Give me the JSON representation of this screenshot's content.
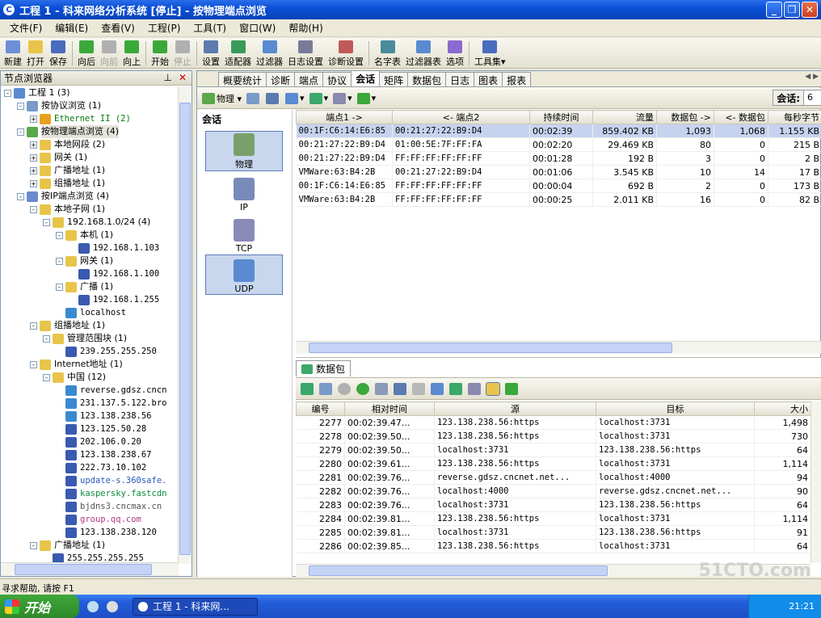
{
  "window": {
    "title": "工程 1 - 科来网络分析系统 [停止] - 按物理端点浏览"
  },
  "menu": [
    "文件(F)",
    "编辑(E)",
    "查看(V)",
    "工程(P)",
    "工具(T)",
    "窗口(W)",
    "帮助(H)"
  ],
  "toolbar": [
    {
      "label": "新建",
      "icon": "new-icon",
      "color": "#6d8fd8"
    },
    {
      "label": "打开",
      "icon": "open-icon",
      "color": "#e8c44a"
    },
    {
      "label": "保存",
      "icon": "save-icon",
      "color": "#4a6cc0"
    },
    {
      "label": "向后",
      "icon": "back-icon",
      "color": "#3aa83a"
    },
    {
      "label": "向前",
      "icon": "forward-icon",
      "color": "#b0b0b0",
      "disabled": true
    },
    {
      "label": "向上",
      "icon": "up-icon",
      "color": "#3aa83a"
    },
    {
      "label": "开始",
      "icon": "start-icon",
      "color": "#3aa83a"
    },
    {
      "label": "停止",
      "icon": "stop-icon",
      "color": "#b0b0b0",
      "disabled": true
    },
    {
      "label": "设置",
      "icon": "settings-icon",
      "color": "#5a7ab0"
    },
    {
      "label": "适配器",
      "icon": "adapter-icon",
      "color": "#3a9a5a"
    },
    {
      "label": "过滤器",
      "icon": "filter-icon",
      "color": "#5a8ad0"
    },
    {
      "label": "日志设置",
      "icon": "log-settings-icon",
      "color": "#7a7a9a"
    },
    {
      "label": "诊断设置",
      "icon": "diagnosis-settings-icon",
      "color": "#c05a5a"
    },
    {
      "label": "名字表",
      "icon": "name-table-icon",
      "color": "#4a8a9a"
    },
    {
      "label": "过滤器表",
      "icon": "filter-table-icon",
      "color": "#5a8ad0"
    },
    {
      "label": "选项",
      "icon": "options-icon",
      "color": "#8a6ad0"
    },
    {
      "label": "工具集▾",
      "icon": "toolset-icon",
      "color": "#4a6cc0"
    }
  ],
  "left_pane": {
    "title": "节点浏览器",
    "tree": [
      {
        "label": "工程 1 (3)",
        "level": 0,
        "exp": "-",
        "icon": "globe-icon",
        "color": "#5a8ad0"
      },
      {
        "label": "按协议浏览 (1)",
        "level": 1,
        "exp": "-",
        "icon": "filter-icon",
        "color": "#7a9ac8"
      },
      {
        "label": "Ethernet II (2)",
        "level": 2,
        "exp": "+",
        "icon": "filter-icon",
        "color": "#e8a020",
        "mono": true,
        "textcolor": "#0a7a0a"
      },
      {
        "label": "按物理端点浏览 (4)",
        "level": 1,
        "exp": "-",
        "icon": "network-icon",
        "color": "#5aa84a",
        "sel": true
      },
      {
        "label": "本地网段 (2)",
        "level": 2,
        "exp": "+",
        "icon": "folder-icon",
        "color": "#e8c44a"
      },
      {
        "label": "网关 (1)",
        "level": 2,
        "exp": "+",
        "icon": "folder-icon",
        "color": "#e8c44a"
      },
      {
        "label": "广播地址 (1)",
        "level": 2,
        "exp": "+",
        "icon": "folder-icon",
        "color": "#e8c44a"
      },
      {
        "label": "组播地址 (1)",
        "level": 2,
        "exp": "+",
        "icon": "folder-icon",
        "color": "#e8c44a"
      },
      {
        "label": "按IP端点浏览 (4)",
        "level": 1,
        "exp": "-",
        "icon": "network-icon",
        "color": "#6a8ad0"
      },
      {
        "label": "本地子网 (1)",
        "level": 2,
        "exp": "-",
        "icon": "folder-icon",
        "color": "#e8c44a"
      },
      {
        "label": "192.168.1.0/24 (4)",
        "level": 3,
        "exp": "-",
        "icon": "folder-icon",
        "color": "#e8c44a"
      },
      {
        "label": "本机 (1)",
        "level": 4,
        "exp": "-",
        "icon": "folder-icon",
        "color": "#e8c44a"
      },
      {
        "label": "192.168.1.103",
        "level": 5,
        "exp": "",
        "icon": "computer-icon",
        "color": "#3a5ab0",
        "mono": true
      },
      {
        "label": "网关 (1)",
        "level": 4,
        "exp": "-",
        "icon": "folder-icon",
        "color": "#e8c44a"
      },
      {
        "label": "192.168.1.100",
        "level": 5,
        "exp": "",
        "icon": "computer-icon",
        "color": "#3a5ab0",
        "mono": true
      },
      {
        "label": "广播 (1)",
        "level": 4,
        "exp": "-",
        "icon": "folder-icon",
        "color": "#e8c44a"
      },
      {
        "label": "192.168.1.255",
        "level": 5,
        "exp": "",
        "icon": "computer-icon",
        "color": "#3a5ab0",
        "mono": true
      },
      {
        "label": "localhost",
        "level": 4,
        "exp": "",
        "icon": "computer-icon",
        "color": "#3a8ad0",
        "mono": true
      },
      {
        "label": "组播地址 (1)",
        "level": 2,
        "exp": "-",
        "icon": "folder-icon",
        "color": "#e8c44a"
      },
      {
        "label": "管理范围块 (1)",
        "level": 3,
        "exp": "-",
        "icon": "folder-icon",
        "color": "#e8c44a"
      },
      {
        "label": "239.255.255.250",
        "level": 4,
        "exp": "",
        "icon": "computer-icon",
        "color": "#3a5ab0",
        "mono": true
      },
      {
        "label": "Internet地址 (1)",
        "level": 2,
        "exp": "-",
        "icon": "folder-icon",
        "color": "#e8c44a"
      },
      {
        "label": "中国 (12)",
        "level": 3,
        "exp": "-",
        "icon": "folder-icon",
        "color": "#e8c44a"
      },
      {
        "label": "reverse.gdsz.cncn",
        "level": 4,
        "exp": "",
        "icon": "computer-icon",
        "color": "#3a8ad0",
        "mono": true
      },
      {
        "label": "231.137.5.122.bro",
        "level": 4,
        "exp": "",
        "icon": "computer-icon",
        "color": "#3a8ad0",
        "mono": true
      },
      {
        "label": "123.138.238.56",
        "level": 4,
        "exp": "",
        "icon": "computer-icon",
        "color": "#3a8ad0",
        "mono": true
      },
      {
        "label": "123.125.50.28",
        "level": 4,
        "exp": "",
        "icon": "computer-icon",
        "color": "#3a5ab0",
        "mono": true
      },
      {
        "label": "202.106.0.20",
        "level": 4,
        "exp": "",
        "icon": "computer-icon",
        "color": "#3a5ab0",
        "mono": true
      },
      {
        "label": "123.138.238.67",
        "level": 4,
        "exp": "",
        "icon": "computer-icon",
        "color": "#3a5ab0",
        "mono": true
      },
      {
        "label": "222.73.10.102",
        "level": 4,
        "exp": "",
        "icon": "computer-icon",
        "color": "#3a5ab0",
        "mono": true
      },
      {
        "label": "update-s.360safe.",
        "level": 4,
        "exp": "",
        "icon": "computer-icon",
        "color": "#3a5ab0",
        "mono": true,
        "textcolor": "#2a5ab8"
      },
      {
        "label": "kaspersky.fastcdn",
        "level": 4,
        "exp": "",
        "icon": "computer-icon",
        "color": "#3a5ab0",
        "mono": true,
        "textcolor": "#0a8a3a"
      },
      {
        "label": "bjdns3.cncmax.cn",
        "level": 4,
        "exp": "",
        "icon": "computer-icon",
        "color": "#3a5ab0",
        "mono": true,
        "textcolor": "#555555"
      },
      {
        "label": "group.qq.com",
        "level": 4,
        "exp": "",
        "icon": "computer-icon",
        "color": "#3a5ab0",
        "mono": true,
        "textcolor": "#b03a8a"
      },
      {
        "label": "123.138.238.120",
        "level": 4,
        "exp": "",
        "icon": "computer-icon",
        "color": "#3a5ab0",
        "mono": true
      },
      {
        "label": "广播地址 (1)",
        "level": 2,
        "exp": "-",
        "icon": "folder-icon",
        "color": "#e8c44a"
      },
      {
        "label": "255.255.255.255",
        "level": 3,
        "exp": "",
        "icon": "computer-icon",
        "color": "#3a5ab0",
        "mono": true
      }
    ]
  },
  "tabs": [
    "概要统计",
    "诊断",
    "端点",
    "协议",
    "会话",
    "矩阵",
    "数据包",
    "日志",
    "图表",
    "报表"
  ],
  "active_tab": "会话",
  "subtoolbar": {
    "physical_label": "物理 ▾"
  },
  "session_counter": {
    "label": "会话:",
    "value": "6"
  },
  "categories": {
    "title": "会话",
    "items": [
      {
        "label": "物理",
        "sel": true,
        "color": "#7aa06a"
      },
      {
        "label": "IP",
        "sel": false,
        "color": "#7a8ab8"
      },
      {
        "label": "TCP",
        "sel": false,
        "color": "#8a8ab8"
      },
      {
        "label": "UDP",
        "sel": true,
        "color": "#5a8ad0"
      }
    ]
  },
  "sessions": {
    "columns": [
      "端点1 ->",
      "<- 端点2",
      "持续时间",
      "流量",
      "数据包 ->",
      "<- 数据包",
      "每秒字节"
    ],
    "rows": [
      [
        "00:1F:C6:14:E6:85",
        "00:21:27:22:B9:D4",
        "00:02:39",
        "859.402 KB",
        "1,093",
        "1,068",
        "1.155 KB"
      ],
      [
        "00:21:27:22:B9:D4",
        "01:00:5E:7F:FF:FA",
        "00:02:20",
        "29.469 KB",
        "80",
        "0",
        "215 B"
      ],
      [
        "00:21:27:22:B9:D4",
        "FF:FF:FF:FF:FF:FF",
        "00:01:28",
        "192  B",
        "3",
        "0",
        "2 B"
      ],
      [
        "VMWare:63:B4:2B",
        "00:21:27:22:B9:D4",
        "00:01:06",
        "3.545 KB",
        "10",
        "14",
        "17 B"
      ],
      [
        "00:1F:C6:14:E6:85",
        "FF:FF:FF:FF:FF:FF",
        "00:00:04",
        "692  B",
        "2",
        "0",
        "173 B"
      ],
      [
        "VMWare:63:B4:2B",
        "FF:FF:FF:FF:FF:FF",
        "00:00:25",
        "2.011 KB",
        "16",
        "0",
        "82 B"
      ]
    ]
  },
  "packets": {
    "tab_label": "数据包",
    "columns": [
      "编号",
      "相对时间",
      "源",
      "目标",
      "大小"
    ],
    "rows": [
      [
        "2277",
        "00:02:39.47...",
        "123.138.238.56:https",
        "localhost:3731",
        "1,498"
      ],
      [
        "2278",
        "00:02:39.50...",
        "123.138.238.56:https",
        "localhost:3731",
        "730"
      ],
      [
        "2279",
        "00:02:39.50...",
        "localhost:3731",
        "123.138.238.56:https",
        "64"
      ],
      [
        "2280",
        "00:02:39.61...",
        "123.138.238.56:https",
        "localhost:3731",
        "1,114"
      ],
      [
        "2281",
        "00:02:39.76...",
        "reverse.gdsz.cncnet.net...",
        "localhost:4000",
        "94"
      ],
      [
        "2282",
        "00:02:39.76...",
        "localhost:4000",
        "reverse.gdsz.cncnet.net...",
        "90"
      ],
      [
        "2283",
        "00:02:39.76...",
        "localhost:3731",
        "123.138.238.56:https",
        "64"
      ],
      [
        "2284",
        "00:02:39.81...",
        "123.138.238.56:https",
        "localhost:3731",
        "1,114"
      ],
      [
        "2285",
        "00:02:39.81...",
        "localhost:3731",
        "123.138.238.56:https",
        "91"
      ],
      [
        "2286",
        "00:02:39.85...",
        "123.138.238.56:https",
        "localhost:3731",
        "64"
      ]
    ]
  },
  "status": {
    "text": "寻求帮助, 请按 F1"
  },
  "taskbar": {
    "start": "开始",
    "task": "工程 1 - 科来网...",
    "clock": "21:21"
  },
  "watermark": "51CTO.com"
}
